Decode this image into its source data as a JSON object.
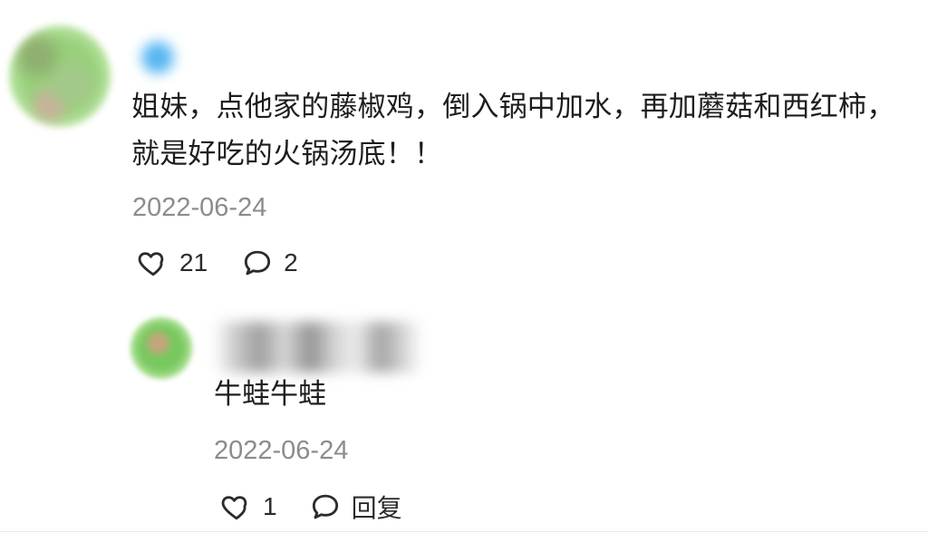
{
  "comment": {
    "text": "姐妹，点他家的藤椒鸡，倒入锅中加水，再加蘑菇和西红柿，就是好吃的火锅汤底！！",
    "date": "2022-06-24",
    "likes": "21",
    "replies": "2"
  },
  "reply": {
    "text": "牛蛙牛蛙",
    "date": "2022-06-24",
    "likes": "1",
    "reply_label": "回复"
  },
  "icons": {
    "like": "heart-outline-icon",
    "comment": "speech-bubble-icon"
  },
  "colors": {
    "text": "#1d1d1d",
    "muted": "#8c8c8c",
    "icon": "#2b2b2b"
  }
}
